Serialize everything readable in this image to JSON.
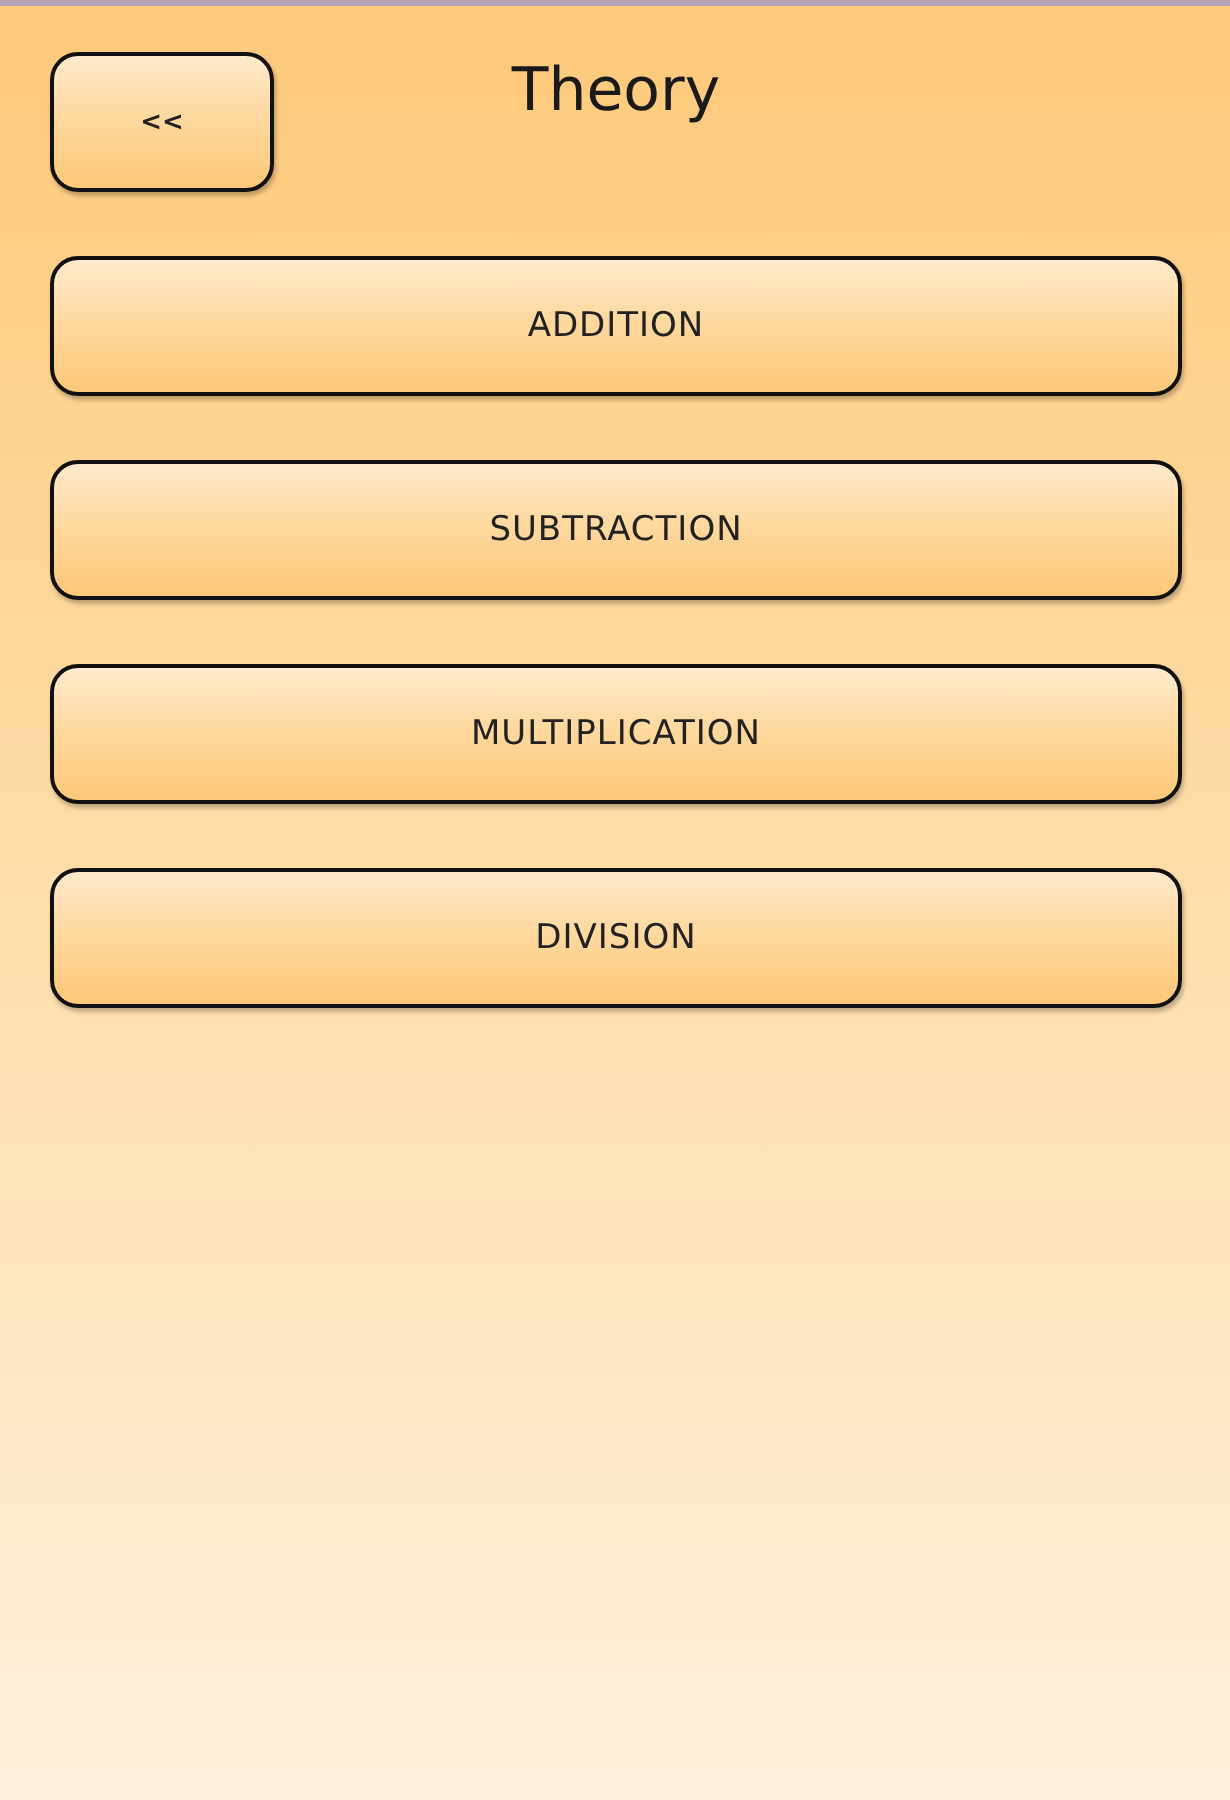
{
  "back_button": {
    "label": "<<"
  },
  "title": "Theory",
  "menu": [
    {
      "label": "ADDITION"
    },
    {
      "label": "SUBTRACTION"
    },
    {
      "label": "MULTIPLICATION"
    },
    {
      "label": "DIVISION"
    }
  ]
}
